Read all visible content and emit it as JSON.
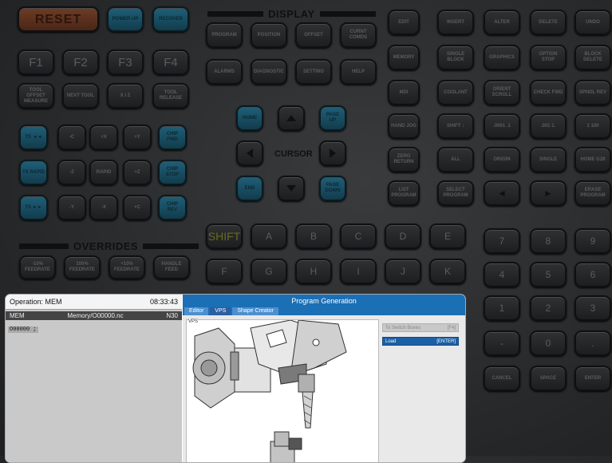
{
  "top_keys": {
    "reset": "RESET",
    "power_up": "POWER UP",
    "recover": "RECOVER"
  },
  "display": {
    "header": "DISPLAY",
    "row1": [
      "PROGRAM",
      "POSITION",
      "OFFSET",
      "CURNT COMDS"
    ],
    "row2": [
      "ALARMS",
      "DIAGNOSTIC",
      "SETTING",
      "HELP"
    ]
  },
  "fkeys": [
    "F1",
    "F2",
    "F3",
    "F4"
  ],
  "f_sub": [
    "TOOL OFFSET MEASURE",
    "NEXT TOOL",
    "X / Z",
    "TOOL RELEASE"
  ],
  "jog": {
    "r1": [
      "TS ◄◄",
      "-C",
      "+X",
      "+Y",
      "CHIP FWD"
    ],
    "r2": [
      "TS RAPID",
      "-Z",
      "RAPID",
      "+Z",
      "CHIP STOP"
    ],
    "r3": [
      "TS ►►",
      "-Y",
      "-X",
      "+C",
      "CHIP REV"
    ]
  },
  "cursor": {
    "label": "CURSOR",
    "home": "HOME",
    "page_up": "PAGE UP",
    "end": "END",
    "page_down": "PAGE DOWN"
  },
  "overrides": {
    "header": "OVERRIDES",
    "keys": [
      "-10% FEEDRATE",
      "100% FEEDRATE",
      "+10% FEEDRATE",
      "HANDLE FEED"
    ]
  },
  "shift": "SHIFT",
  "letters": {
    "r1": [
      "A",
      "B",
      "C",
      "D",
      "E"
    ],
    "r2": [
      "F",
      "G",
      "H",
      "I",
      "J",
      "K"
    ]
  },
  "edit_keys": {
    "c1": [
      "EDIT",
      "MEMORY",
      "MDI",
      "HAND JOG",
      "ZERO RETURN",
      "LIST PROGRAM"
    ],
    "c2": [
      "INSERT",
      "SINGLE BLOCK",
      "COOLANT",
      "SHIFT ↕",
      "ALL",
      "SELECT PROGRAM"
    ],
    "c3": [
      "ALTER",
      "GRAPHICS",
      "ORIENT SCROLL",
      ".0001 .1",
      "ORIGIN",
      "◄"
    ],
    "c4": [
      "DELETE",
      "OPTION STOP",
      "CHECK FWD",
      ".001 1.",
      "SINGLE",
      "►"
    ],
    "c5": [
      "UNDO",
      "BLOCK DELETE",
      "SPNDL REV",
      "1 100",
      "HOME G28",
      "ERASE PROGRAM"
    ]
  },
  "numpad": {
    "r1": [
      "7",
      "8",
      "9"
    ],
    "r2": [
      "4",
      "5",
      "6"
    ],
    "r3": [
      "1",
      "2",
      "3"
    ],
    "r4": [
      "-",
      "0",
      "."
    ],
    "r5": [
      "CANCEL",
      "SPACE",
      "ENTER"
    ]
  },
  "screen": {
    "operation": "Operation: MEM",
    "time": "08:33:43",
    "mode": "MEM",
    "path": "Memory/O00000.nc",
    "block": "N30",
    "program_line": "O00000 ;",
    "title": "Program Generation",
    "tabs": [
      "Editor",
      "VPS",
      "Shape Creator"
    ],
    "vps_label": "VPS",
    "switch_label": "To Switch Boxes",
    "switch_key": "[F4]",
    "load_label": "Load",
    "load_key": "[ENTER]"
  }
}
